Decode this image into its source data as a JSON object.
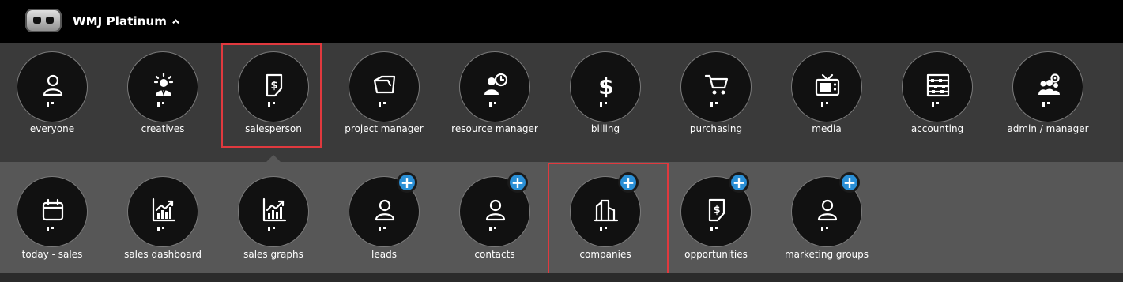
{
  "header": {
    "app_name": "WMJ Platinum"
  },
  "roles": [
    {
      "label": "everyone",
      "icon": "person-icon"
    },
    {
      "label": "creatives",
      "icon": "creative-person-icon"
    },
    {
      "label": "salesperson",
      "icon": "dollar-document-icon",
      "selected": true
    },
    {
      "label": "project manager",
      "icon": "folder-icon"
    },
    {
      "label": "resource manager",
      "icon": "person-clock-icon"
    },
    {
      "label": "billing",
      "icon": "dollar-icon"
    },
    {
      "label": "purchasing",
      "icon": "cart-icon"
    },
    {
      "label": "media",
      "icon": "tv-icon"
    },
    {
      "label": "accounting",
      "icon": "abacus-icon"
    },
    {
      "label": "admin / manager",
      "icon": "group-gear-icon"
    }
  ],
  "sales_items": [
    {
      "label": "today - sales",
      "icon": "calendar-icon",
      "has_add": false
    },
    {
      "label": "sales dashboard",
      "icon": "bar-chart-icon",
      "has_add": false
    },
    {
      "label": "sales graphs",
      "icon": "bar-chart-icon",
      "has_add": false
    },
    {
      "label": "leads",
      "icon": "person-icon",
      "has_add": true
    },
    {
      "label": "contacts",
      "icon": "person-icon",
      "has_add": true
    },
    {
      "label": "companies",
      "icon": "buildings-icon",
      "has_add": true,
      "highlighted": true
    },
    {
      "label": "opportunities",
      "icon": "dollar-document-icon",
      "has_add": true
    },
    {
      "label": "marketing groups",
      "icon": "person-icon",
      "has_add": true
    }
  ],
  "colors": {
    "top_bar": "#000000",
    "roles_bar": "#3a3a3a",
    "items_bar": "#575757",
    "add_badge": "#2a8fd6",
    "highlight": "#e0393e"
  }
}
